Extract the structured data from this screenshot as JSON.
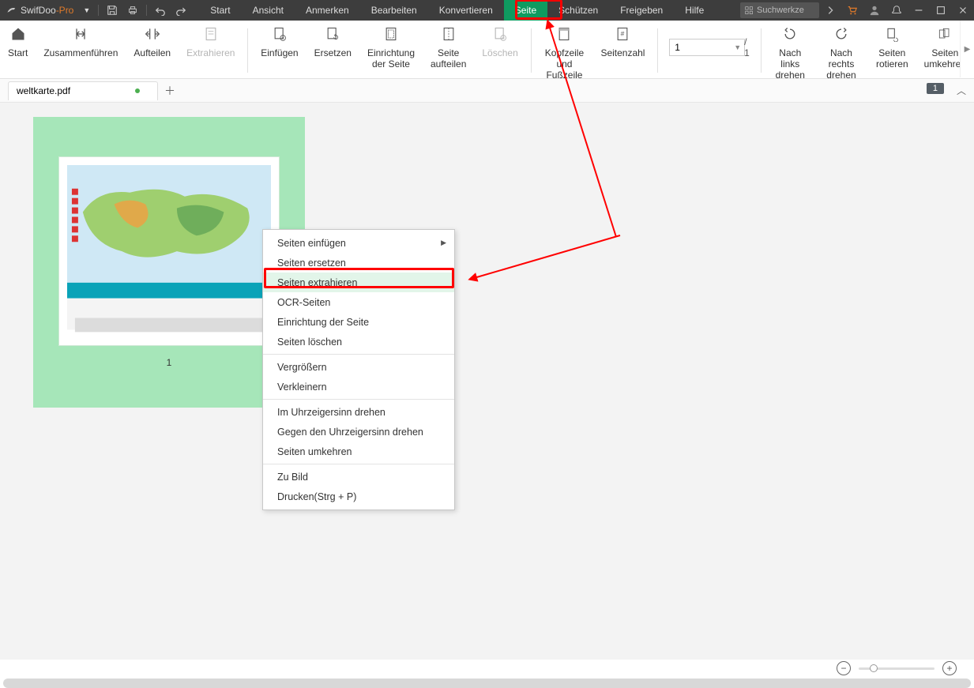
{
  "app": {
    "name": "SwifDoo",
    "suffix": "-Pro"
  },
  "menus": [
    "Start",
    "Ansicht",
    "Anmerken",
    "Bearbeiten",
    "Konvertieren",
    "Seite",
    "Schützen",
    "Freigeben",
    "Hilfe"
  ],
  "activeMenuIndex": 5,
  "searchTools": "Suchwerkze",
  "ribbon": {
    "start": "Start",
    "merge": "Zusammenführen",
    "split": "Aufteilen",
    "extract": "Extrahieren",
    "insert": "Einfügen",
    "replace": "Ersetzen",
    "pageSetup1": "Einrichtung",
    "pageSetup2": "der Seite",
    "splitPage1": "Seite",
    "splitPage2": "aufteilen",
    "delete": "Löschen",
    "headerFooter1": "Kopfzeile",
    "headerFooter2": "und Fußzeile",
    "pageNumber": "Seitenzahl",
    "pageInputValue": "1",
    "pageTotal": "/ 1",
    "rotateLeft1": "Nach links",
    "rotateLeft2": "drehen",
    "rotateRight1": "Nach rechts",
    "rotateRight2": "drehen",
    "rotate1": "Seiten",
    "rotate2": "rotieren",
    "reverse1": "Seiten",
    "reverse2": "umkehren"
  },
  "doc": {
    "filename": "weltkarte.pdf"
  },
  "tabsBadge": "1",
  "thumb": {
    "number": "1"
  },
  "ctx": {
    "insert": "Seiten einfügen",
    "replace": "Seiten ersetzen",
    "extract": "Seiten extrahieren",
    "ocr": "OCR-Seiten",
    "pagesetup": "Einrichtung der Seite",
    "delete": "Seiten löschen",
    "zoomin": "Vergrößern",
    "zoomout": "Verkleinern",
    "rotatecw": "Im Uhrzeigersinn drehen",
    "rotateccw": "Gegen den Uhrzeigersinn drehen",
    "reverse": "Seiten umkehren",
    "toimage": "Zu Bild",
    "print": "Drucken(Strg + P)"
  }
}
